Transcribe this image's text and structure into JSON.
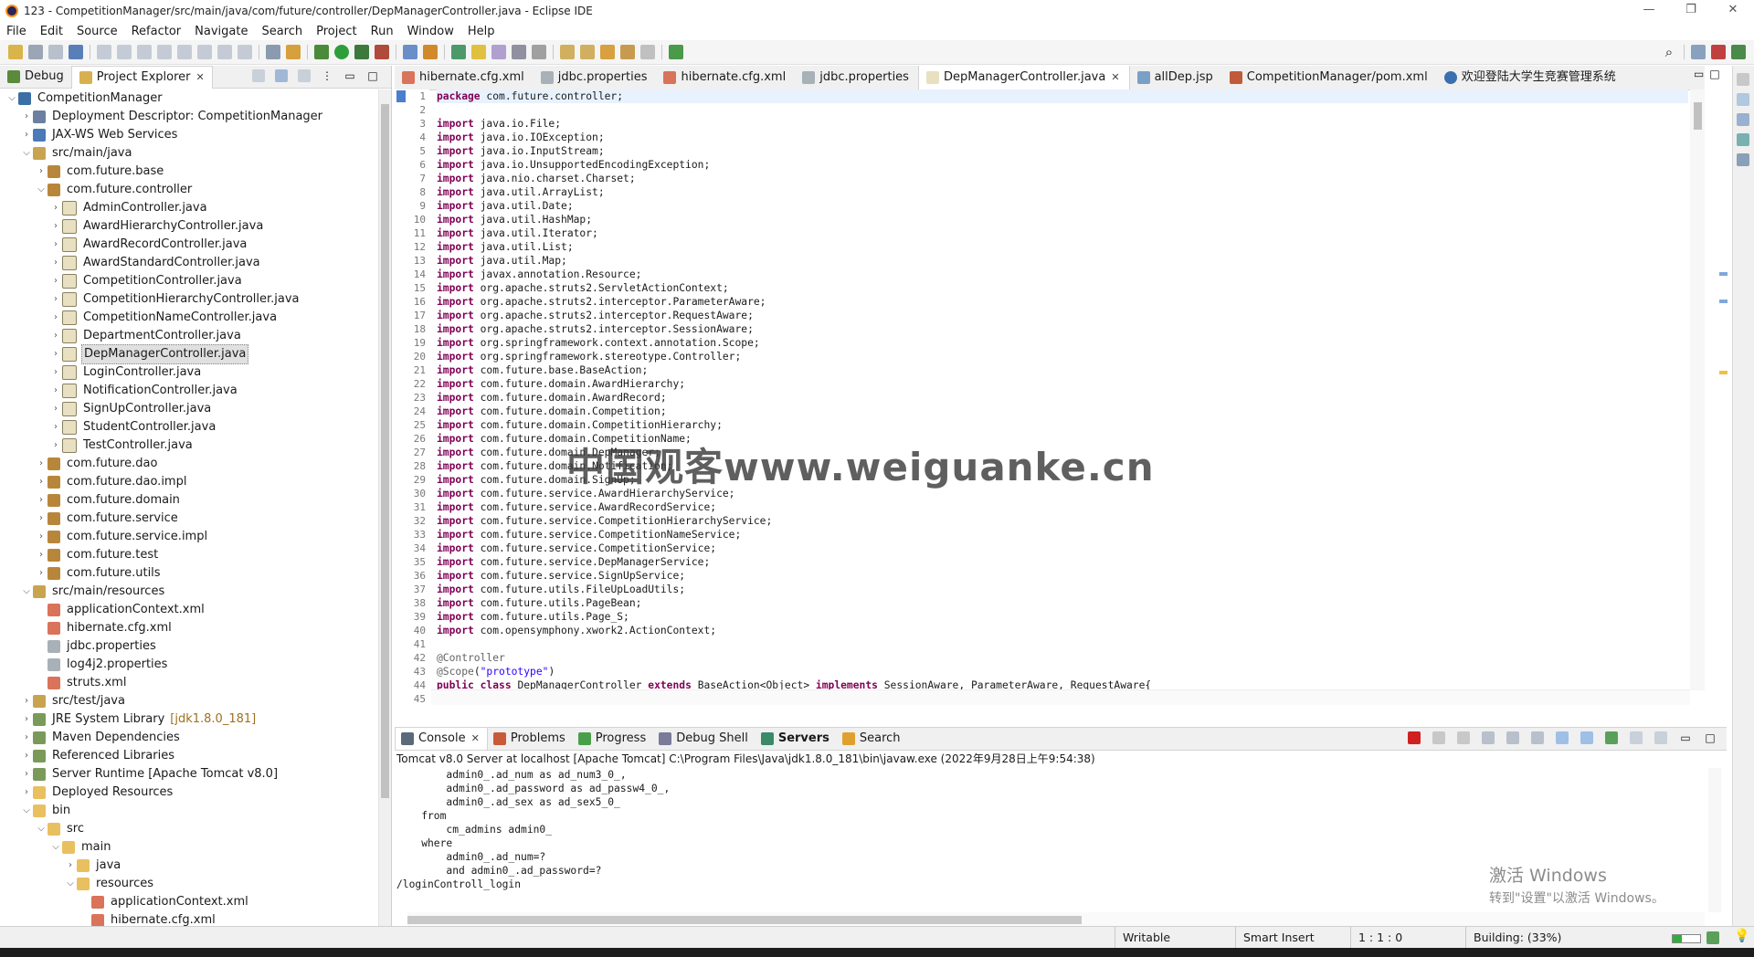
{
  "window": {
    "title": "123 - CompetitionManager/src/main/java/com/future/controller/DepManagerController.java - Eclipse IDE",
    "controls": [
      "—",
      "❐",
      "✕"
    ]
  },
  "menu": [
    "File",
    "Edit",
    "Source",
    "Refactor",
    "Navigate",
    "Search",
    "Project",
    "Run",
    "Window",
    "Help"
  ],
  "left_panel": {
    "tabs": [
      {
        "label": "Debug",
        "icon": "debug-icon",
        "active": false
      },
      {
        "label": "Project Explorer",
        "icon": "project-explorer-icon",
        "active": true
      }
    ],
    "tree": [
      {
        "depth": 0,
        "twisty": "v",
        "icon": "project-icon",
        "label": "CompetitionManager"
      },
      {
        "depth": 1,
        "twisty": ">",
        "icon": "descriptor-icon",
        "label": "Deployment Descriptor: CompetitionManager"
      },
      {
        "depth": 1,
        "twisty": ">",
        "icon": "webservices-icon",
        "label": "JAX-WS Web Services"
      },
      {
        "depth": 1,
        "twisty": "v",
        "icon": "source-folder-icon",
        "label": "src/main/java"
      },
      {
        "depth": 2,
        "twisty": ">",
        "icon": "package-icon",
        "label": "com.future.base"
      },
      {
        "depth": 2,
        "twisty": "v",
        "icon": "package-icon",
        "label": "com.future.controller"
      },
      {
        "depth": 3,
        "twisty": ">",
        "icon": "java-file-icon",
        "label": "AdminController.java"
      },
      {
        "depth": 3,
        "twisty": ">",
        "icon": "java-file-icon",
        "label": "AwardHierarchyController.java"
      },
      {
        "depth": 3,
        "twisty": ">",
        "icon": "java-file-icon",
        "label": "AwardRecordController.java"
      },
      {
        "depth": 3,
        "twisty": ">",
        "icon": "java-file-icon",
        "label": "AwardStandardController.java"
      },
      {
        "depth": 3,
        "twisty": ">",
        "icon": "java-file-icon",
        "label": "CompetitionController.java"
      },
      {
        "depth": 3,
        "twisty": ">",
        "icon": "java-file-icon",
        "label": "CompetitionHierarchyController.java"
      },
      {
        "depth": 3,
        "twisty": ">",
        "icon": "java-file-icon",
        "label": "CompetitionNameController.java"
      },
      {
        "depth": 3,
        "twisty": ">",
        "icon": "java-file-icon",
        "label": "DepartmentController.java"
      },
      {
        "depth": 3,
        "twisty": ">",
        "icon": "java-file-icon",
        "label": "DepManagerController.java",
        "selected": true
      },
      {
        "depth": 3,
        "twisty": ">",
        "icon": "java-file-icon",
        "label": "LoginController.java"
      },
      {
        "depth": 3,
        "twisty": ">",
        "icon": "java-file-icon",
        "label": "NotificationController.java"
      },
      {
        "depth": 3,
        "twisty": ">",
        "icon": "java-file-icon",
        "label": "SignUpController.java"
      },
      {
        "depth": 3,
        "twisty": ">",
        "icon": "java-file-icon",
        "label": "StudentController.java"
      },
      {
        "depth": 3,
        "twisty": ">",
        "icon": "java-file-icon",
        "label": "TestController.java"
      },
      {
        "depth": 2,
        "twisty": ">",
        "icon": "package-icon",
        "label": "com.future.dao"
      },
      {
        "depth": 2,
        "twisty": ">",
        "icon": "package-icon",
        "label": "com.future.dao.impl"
      },
      {
        "depth": 2,
        "twisty": ">",
        "icon": "package-icon",
        "label": "com.future.domain"
      },
      {
        "depth": 2,
        "twisty": ">",
        "icon": "package-icon",
        "label": "com.future.service"
      },
      {
        "depth": 2,
        "twisty": ">",
        "icon": "package-icon",
        "label": "com.future.service.impl"
      },
      {
        "depth": 2,
        "twisty": ">",
        "icon": "package-icon",
        "label": "com.future.test"
      },
      {
        "depth": 2,
        "twisty": ">",
        "icon": "package-icon",
        "label": "com.future.utils"
      },
      {
        "depth": 1,
        "twisty": "v",
        "icon": "source-folder-icon",
        "label": "src/main/resources"
      },
      {
        "depth": 2,
        "twisty": "",
        "icon": "xml-file-icon",
        "label": "applicationContext.xml"
      },
      {
        "depth": 2,
        "twisty": "",
        "icon": "xml-file-icon",
        "label": "hibernate.cfg.xml"
      },
      {
        "depth": 2,
        "twisty": "",
        "icon": "properties-file-icon",
        "label": "jdbc.properties"
      },
      {
        "depth": 2,
        "twisty": "",
        "icon": "properties-file-icon",
        "label": "log4j2.properties"
      },
      {
        "depth": 2,
        "twisty": "",
        "icon": "xml-file-icon",
        "label": "struts.xml"
      },
      {
        "depth": 1,
        "twisty": ">",
        "icon": "source-folder-icon",
        "label": "src/test/java"
      },
      {
        "depth": 1,
        "twisty": ">",
        "icon": "library-icon",
        "label": "JRE System Library",
        "annotation": "[jdk1.8.0_181]"
      },
      {
        "depth": 1,
        "twisty": ">",
        "icon": "library-icon",
        "label": "Maven Dependencies"
      },
      {
        "depth": 1,
        "twisty": ">",
        "icon": "library-icon",
        "label": "Referenced Libraries"
      },
      {
        "depth": 1,
        "twisty": ">",
        "icon": "library-icon",
        "label": "Server Runtime [Apache Tomcat v8.0]"
      },
      {
        "depth": 1,
        "twisty": ">",
        "icon": "folder-icon",
        "label": "Deployed Resources"
      },
      {
        "depth": 1,
        "twisty": "v",
        "icon": "folder-icon",
        "label": "bin"
      },
      {
        "depth": 2,
        "twisty": "v",
        "icon": "folder-icon",
        "label": "src"
      },
      {
        "depth": 3,
        "twisty": "v",
        "icon": "folder-icon",
        "label": "main"
      },
      {
        "depth": 4,
        "twisty": ">",
        "icon": "folder-icon",
        "label": "java"
      },
      {
        "depth": 4,
        "twisty": "v",
        "icon": "folder-icon",
        "label": "resources"
      },
      {
        "depth": 5,
        "twisty": "",
        "icon": "xml-file-icon",
        "label": "applicationContext.xml"
      },
      {
        "depth": 5,
        "twisty": "",
        "icon": "xml-file-icon",
        "label": "hibernate.cfg.xml"
      }
    ]
  },
  "editor": {
    "tabs": [
      {
        "label": "hibernate.cfg.xml",
        "icon": "xml-file-icon",
        "active": false
      },
      {
        "label": "jdbc.properties",
        "icon": "properties-file-icon",
        "active": false
      },
      {
        "label": "hibernate.cfg.xml",
        "icon": "xml-file-icon",
        "active": false
      },
      {
        "label": "jdbc.properties",
        "icon": "properties-file-icon",
        "active": false
      },
      {
        "label": "DepManagerController.java",
        "icon": "java-file-icon",
        "active": true
      },
      {
        "label": "allDep.jsp",
        "icon": "jsp-file-icon",
        "active": false
      },
      {
        "label": "CompetitionManager/pom.xml",
        "icon": "maven-pom-icon",
        "active": false
      },
      {
        "label": "欢迎登陆大学生竞赛管理系统",
        "icon": "browser-icon",
        "active": false
      }
    ],
    "code_lines": [
      "package com.future.controller;",
      "",
      "import java.io.File;",
      "import java.io.IOException;",
      "import java.io.InputStream;",
      "import java.io.UnsupportedEncodingException;",
      "import java.nio.charset.Charset;",
      "import java.util.ArrayList;",
      "import java.util.Date;",
      "import java.util.HashMap;",
      "import java.util.Iterator;",
      "import java.util.List;",
      "import java.util.Map;",
      "import javax.annotation.Resource;",
      "import org.apache.struts2.ServletActionContext;",
      "import org.apache.struts2.interceptor.ParameterAware;",
      "import org.apache.struts2.interceptor.RequestAware;",
      "import org.apache.struts2.interceptor.SessionAware;",
      "import org.springframework.context.annotation.Scope;",
      "import org.springframework.stereotype.Controller;",
      "import com.future.base.BaseAction;",
      "import com.future.domain.AwardHierarchy;",
      "import com.future.domain.AwardRecord;",
      "import com.future.domain.Competition;",
      "import com.future.domain.CompetitionHierarchy;",
      "import com.future.domain.CompetitionName;",
      "import com.future.domain.DepManager;",
      "import com.future.domain.Notification;",
      "import com.future.domain.SignUp;",
      "import com.future.service.AwardHierarchyService;",
      "import com.future.service.AwardRecordService;",
      "import com.future.service.CompetitionHierarchyService;",
      "import com.future.service.CompetitionNameService;",
      "import com.future.service.CompetitionService;",
      "import com.future.service.DepManagerService;",
      "import com.future.service.SignUpService;",
      "import com.future.utils.FileUpLoadUtils;",
      "import com.future.utils.PageBean;",
      "import com.future.utils.Page_S;",
      "import com.opensymphony.xwork2.ActionContext;",
      "",
      "@Controller",
      "@Scope(\"prototype\")",
      "public class DepManagerController extends BaseAction<Object> implements SessionAware, ParameterAware, RequestAware{",
      ""
    ]
  },
  "console": {
    "tabs": [
      {
        "label": "Console",
        "icon": "console-icon",
        "active": true,
        "closable": true
      },
      {
        "label": "Problems",
        "icon": "problems-icon",
        "active": false
      },
      {
        "label": "Progress",
        "icon": "progress-icon",
        "active": false
      },
      {
        "label": "Debug Shell",
        "icon": "debug-shell-icon",
        "active": false
      },
      {
        "label": "Servers",
        "icon": "servers-icon",
        "active": false,
        "bold": true
      },
      {
        "label": "Search",
        "icon": "search-icon",
        "active": false
      }
    ],
    "description": "Tomcat v8.0 Server at localhost [Apache Tomcat] C:\\Program Files\\Java\\jdk1.8.0_181\\bin\\javaw.exe  (2022年9月28日上午9:54:38)",
    "output_lines": [
      "        admin0_.ad_num as ad_num3_0_,",
      "        admin0_.ad_password as ad_passw4_0_,",
      "        admin0_.ad_sex as ad_sex5_0_",
      "    from",
      "        cm_admins admin0_",
      "    where",
      "        admin0_.ad_num=?",
      "        and admin0_.ad_password=?",
      "/loginControll_login"
    ]
  },
  "watermark": "中国观客www.weiguanke.cn",
  "windows_activation": {
    "line1": "激活 Windows",
    "line2": "转到\"设置\"以激活 Windows。"
  },
  "status": {
    "writable": "Writable",
    "insert_mode": "Smart Insert",
    "position": "1 : 1 : 0",
    "building": "Building: (33%)",
    "building_progress": 0.33
  },
  "colors": {
    "keyword": "#7f0055",
    "string": "#2a00ff",
    "annotation": "#646464",
    "watermark": "#3c3c3c"
  }
}
